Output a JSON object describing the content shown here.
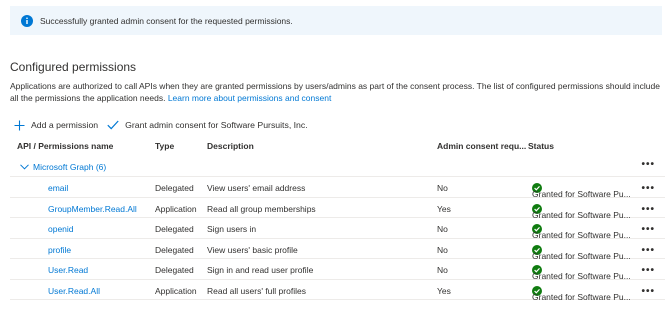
{
  "banner": {
    "message": "Successfully granted admin consent for the requested permissions."
  },
  "section": {
    "title": "Configured permissions",
    "description": "Applications are authorized to call APIs when they are granted permissions by users/admins as part of the consent process. The list of configured permissions should include all the permissions the application needs.",
    "learn_more": "Learn more about permissions and consent"
  },
  "toolbar": {
    "add_label": "Add a permission",
    "grant_label": "Grant admin consent for Software Pursuits, Inc."
  },
  "table": {
    "headers": {
      "name": "API / Permissions name",
      "type": "Type",
      "description": "Description",
      "admin": "Admin consent requ...",
      "status": "Status"
    },
    "group": {
      "label": "Microsoft Graph (6)"
    },
    "rows": [
      {
        "name": "email",
        "type": "Delegated",
        "description": "View users' email address",
        "admin": "No",
        "status": "Granted for Software Pu..."
      },
      {
        "name": "GroupMember.Read.All",
        "type": "Application",
        "description": "Read all group memberships",
        "admin": "Yes",
        "status": "Granted for Software Pu..."
      },
      {
        "name": "openid",
        "type": "Delegated",
        "description": "Sign users in",
        "admin": "No",
        "status": "Granted for Software Pu..."
      },
      {
        "name": "profile",
        "type": "Delegated",
        "description": "View users' basic profile",
        "admin": "No",
        "status": "Granted for Software Pu..."
      },
      {
        "name": "User.Read",
        "type": "Delegated",
        "description": "Sign in and read user profile",
        "admin": "No",
        "status": "Granted for Software Pu..."
      },
      {
        "name": "User.Read.All",
        "type": "Application",
        "description": "Read all users' full profiles",
        "admin": "Yes",
        "status": "Granted for Software Pu..."
      }
    ]
  },
  "colors": {
    "accent": "#0078d4",
    "success": "#107c10",
    "banner_bg": "#eff6fc"
  }
}
